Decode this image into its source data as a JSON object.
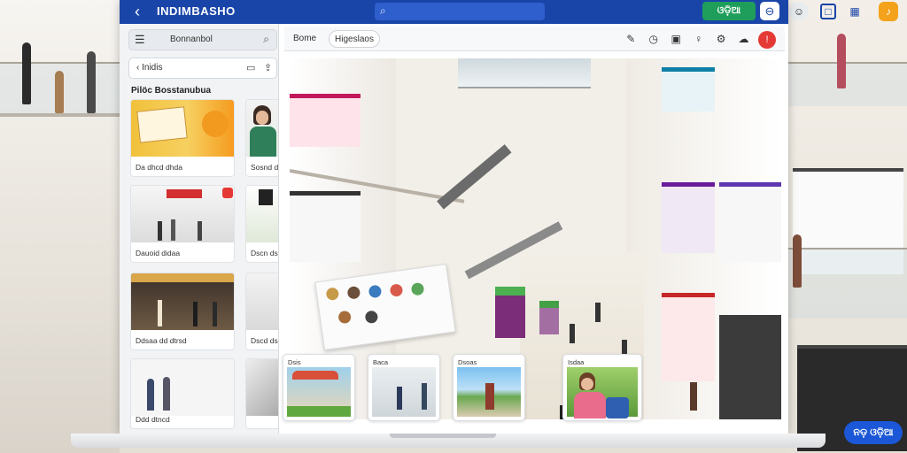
{
  "app": {
    "title": "INDIMBASHO",
    "search_placeholder": "",
    "top_button": "ଓଡ଼ିଆ",
    "back_icon": "arrow-left-icon",
    "account_icon": "account-icon"
  },
  "scene_icons": [
    "face-icon",
    "window-icon",
    "grid-icon",
    "bell-icon"
  ],
  "left_panel": {
    "header_label": "Bonnanbol",
    "tool_label": "Inidis",
    "section_title": "Pilöc Bosstanubua",
    "cards": [
      {
        "caption": "Da dhcd dhda",
        "theme": "products"
      },
      {
        "caption": "Sosnd dhsga",
        "theme": "portrait"
      },
      {
        "caption": "Dauoid didaa",
        "theme": "mall"
      },
      {
        "caption": "Dscn dsoaa",
        "theme": "green"
      },
      {
        "caption": "Ddsaa dd dtrsd",
        "theme": "dark-mall"
      },
      {
        "caption": "Dscd dssa",
        "theme": "gray"
      },
      {
        "caption": "Ddd dtncd",
        "theme": "people"
      },
      {
        "caption": "",
        "theme": "escalator"
      }
    ]
  },
  "main_toolbar": {
    "home_tab": "Bome",
    "pill_tab": "Higeslaos",
    "icons": [
      "edit-icon",
      "clock-icon",
      "square-icon",
      "lightbulb-icon",
      "settings-icon",
      "cloud-icon",
      "alert-icon"
    ]
  },
  "bottom_strip": [
    {
      "label": "Dsis",
      "theme": "market"
    },
    {
      "label": "Baca",
      "theme": "office"
    },
    {
      "label": "Dsoas",
      "theme": "park"
    },
    {
      "label": "Isdaa",
      "theme": "reading"
    }
  ],
  "fab_label": "ନଡ଼ ଓଡ଼ିଆ",
  "colors": {
    "topbar": "#1a45a8",
    "accent_green": "#1e9e5a",
    "fab": "#1b57d6",
    "alert": "#e53935"
  }
}
